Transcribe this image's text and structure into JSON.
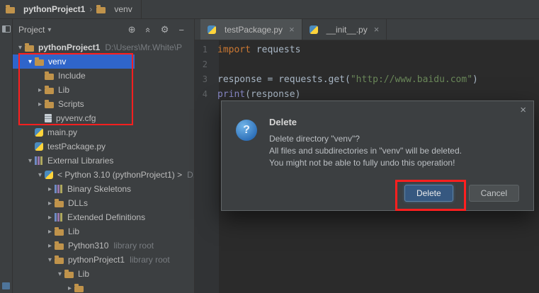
{
  "colors": {
    "annotation_red": "#FF1F1F",
    "selection_blue": "#2F65CA",
    "panel_bg": "#3C3F41",
    "editor_bg": "#2B2B2B",
    "keyword_orange": "#CC7832",
    "string_green": "#6A8759",
    "delete_button_bg": "#365880"
  },
  "breadcrumb": {
    "items": [
      "pythonProject1",
      "venv"
    ],
    "separator": "›"
  },
  "chevron_glyphs": {
    "open": "▾",
    "closed": "▸"
  },
  "project_panel": {
    "title": "Project",
    "caret": "▾",
    "toolbar_icons": [
      {
        "name": "locate-icon",
        "glyph": "⊕"
      },
      {
        "name": "collapse-all-icon",
        "glyph": "«"
      },
      {
        "name": "settings-gear-icon",
        "glyph": "⚙"
      },
      {
        "name": "hide-icon",
        "glyph": "−"
      }
    ],
    "tree": [
      {
        "level": 0,
        "chev": "open",
        "icon": "folder",
        "label": "pythonProject1",
        "suffix": "D:\\Users\\Mr.White\\P",
        "bold": true
      },
      {
        "level": 1,
        "chev": "open",
        "icon": "folder",
        "label": "venv",
        "selected": true
      },
      {
        "level": 2,
        "chev": "none",
        "icon": "folder",
        "label": "Include"
      },
      {
        "level": 2,
        "chev": "closed",
        "icon": "folder",
        "label": "Lib"
      },
      {
        "level": 2,
        "chev": "closed",
        "icon": "folder",
        "label": "Scripts"
      },
      {
        "level": 2,
        "chev": "none",
        "icon": "cfg-file",
        "label": "pyvenv.cfg"
      },
      {
        "level": 1,
        "chev": "none",
        "icon": "python-file",
        "label": "main.py"
      },
      {
        "level": 1,
        "chev": "none",
        "icon": "python-file",
        "label": "testPackage.py"
      },
      {
        "level": 1,
        "chev": "open",
        "icon": "library",
        "label": "External Libraries"
      },
      {
        "level": 2,
        "chev": "open",
        "icon": "python",
        "label": "< Python 3.10 (pythonProject1) >",
        "suffix": "D..."
      },
      {
        "level": 3,
        "chev": "closed",
        "icon": "library",
        "label": "Binary Skeletons"
      },
      {
        "level": 3,
        "chev": "closed",
        "icon": "folder",
        "label": "DLLs"
      },
      {
        "level": 3,
        "chev": "closed",
        "icon": "library",
        "label": "Extended Definitions"
      },
      {
        "level": 3,
        "chev": "closed",
        "icon": "folder",
        "label": "Lib"
      },
      {
        "level": 3,
        "chev": "closed",
        "icon": "folder",
        "label": "Python310",
        "suffix": "library root"
      },
      {
        "level": 3,
        "chev": "open",
        "icon": "folder",
        "label": "pythonProject1",
        "suffix": "library root"
      },
      {
        "level": 4,
        "chev": "open",
        "icon": "folder",
        "label": "Lib"
      },
      {
        "level": 5,
        "chev": "closed",
        "icon": "folder",
        "label": ""
      }
    ]
  },
  "editor": {
    "tabs": [
      {
        "label": "testPackage.py",
        "close": "×",
        "active": true
      },
      {
        "label": "__init__.py",
        "close": "×",
        "active": false
      }
    ],
    "lines": [
      {
        "num": "1",
        "segments": [
          {
            "t": "import",
            "c": "kw"
          },
          {
            "t": " requests",
            "c": "plain"
          }
        ]
      },
      {
        "num": "2",
        "segments": []
      },
      {
        "num": "3",
        "segments": [
          {
            "t": "response = requests.get(",
            "c": "plain"
          },
          {
            "t": "\"http://www.baidu.com\"",
            "c": "str"
          },
          {
            "t": ")",
            "c": "plain"
          }
        ]
      },
      {
        "num": "4",
        "segments": [
          {
            "t": "print",
            "c": "builtin"
          },
          {
            "t": "(response)",
            "c": "plain"
          }
        ]
      }
    ]
  },
  "dialog": {
    "title": "Delete",
    "close": "×",
    "question_mark": "?",
    "message_lines": [
      "Delete directory \"venv\"?",
      "All files and subdirectories in \"venv\" will be deleted.",
      "You might not be able to fully undo this operation!"
    ],
    "buttons": {
      "delete": "Delete",
      "cancel": "Cancel"
    }
  }
}
